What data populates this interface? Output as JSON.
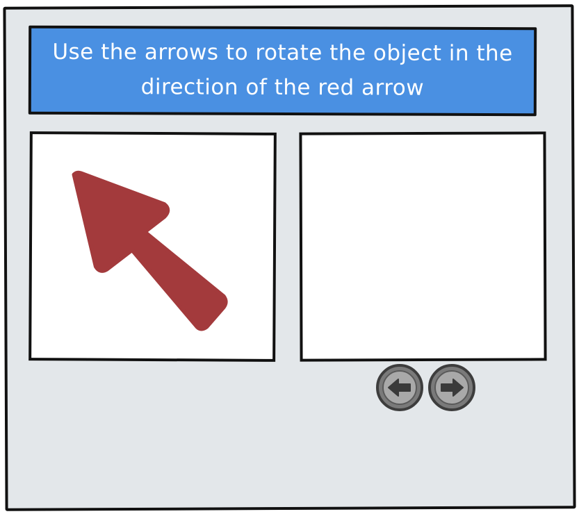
{
  "instruction": {
    "text": "Use the arrows to rotate the object in the direction of the red arrow"
  },
  "target_panel": {
    "arrow_icon": "red-arrow-icon",
    "arrow_color": "#a33a3c",
    "direction": "up-left"
  },
  "controls": {
    "rotate_left_icon": "arrow-left-icon",
    "rotate_right_icon": "arrow-right-icon"
  },
  "colors": {
    "banner": "#4a90e2",
    "background": "#e3e7ea",
    "button": "#7a7a7a",
    "button_inner": "#a9a9a9",
    "button_glyph": "#3a3a3a"
  }
}
